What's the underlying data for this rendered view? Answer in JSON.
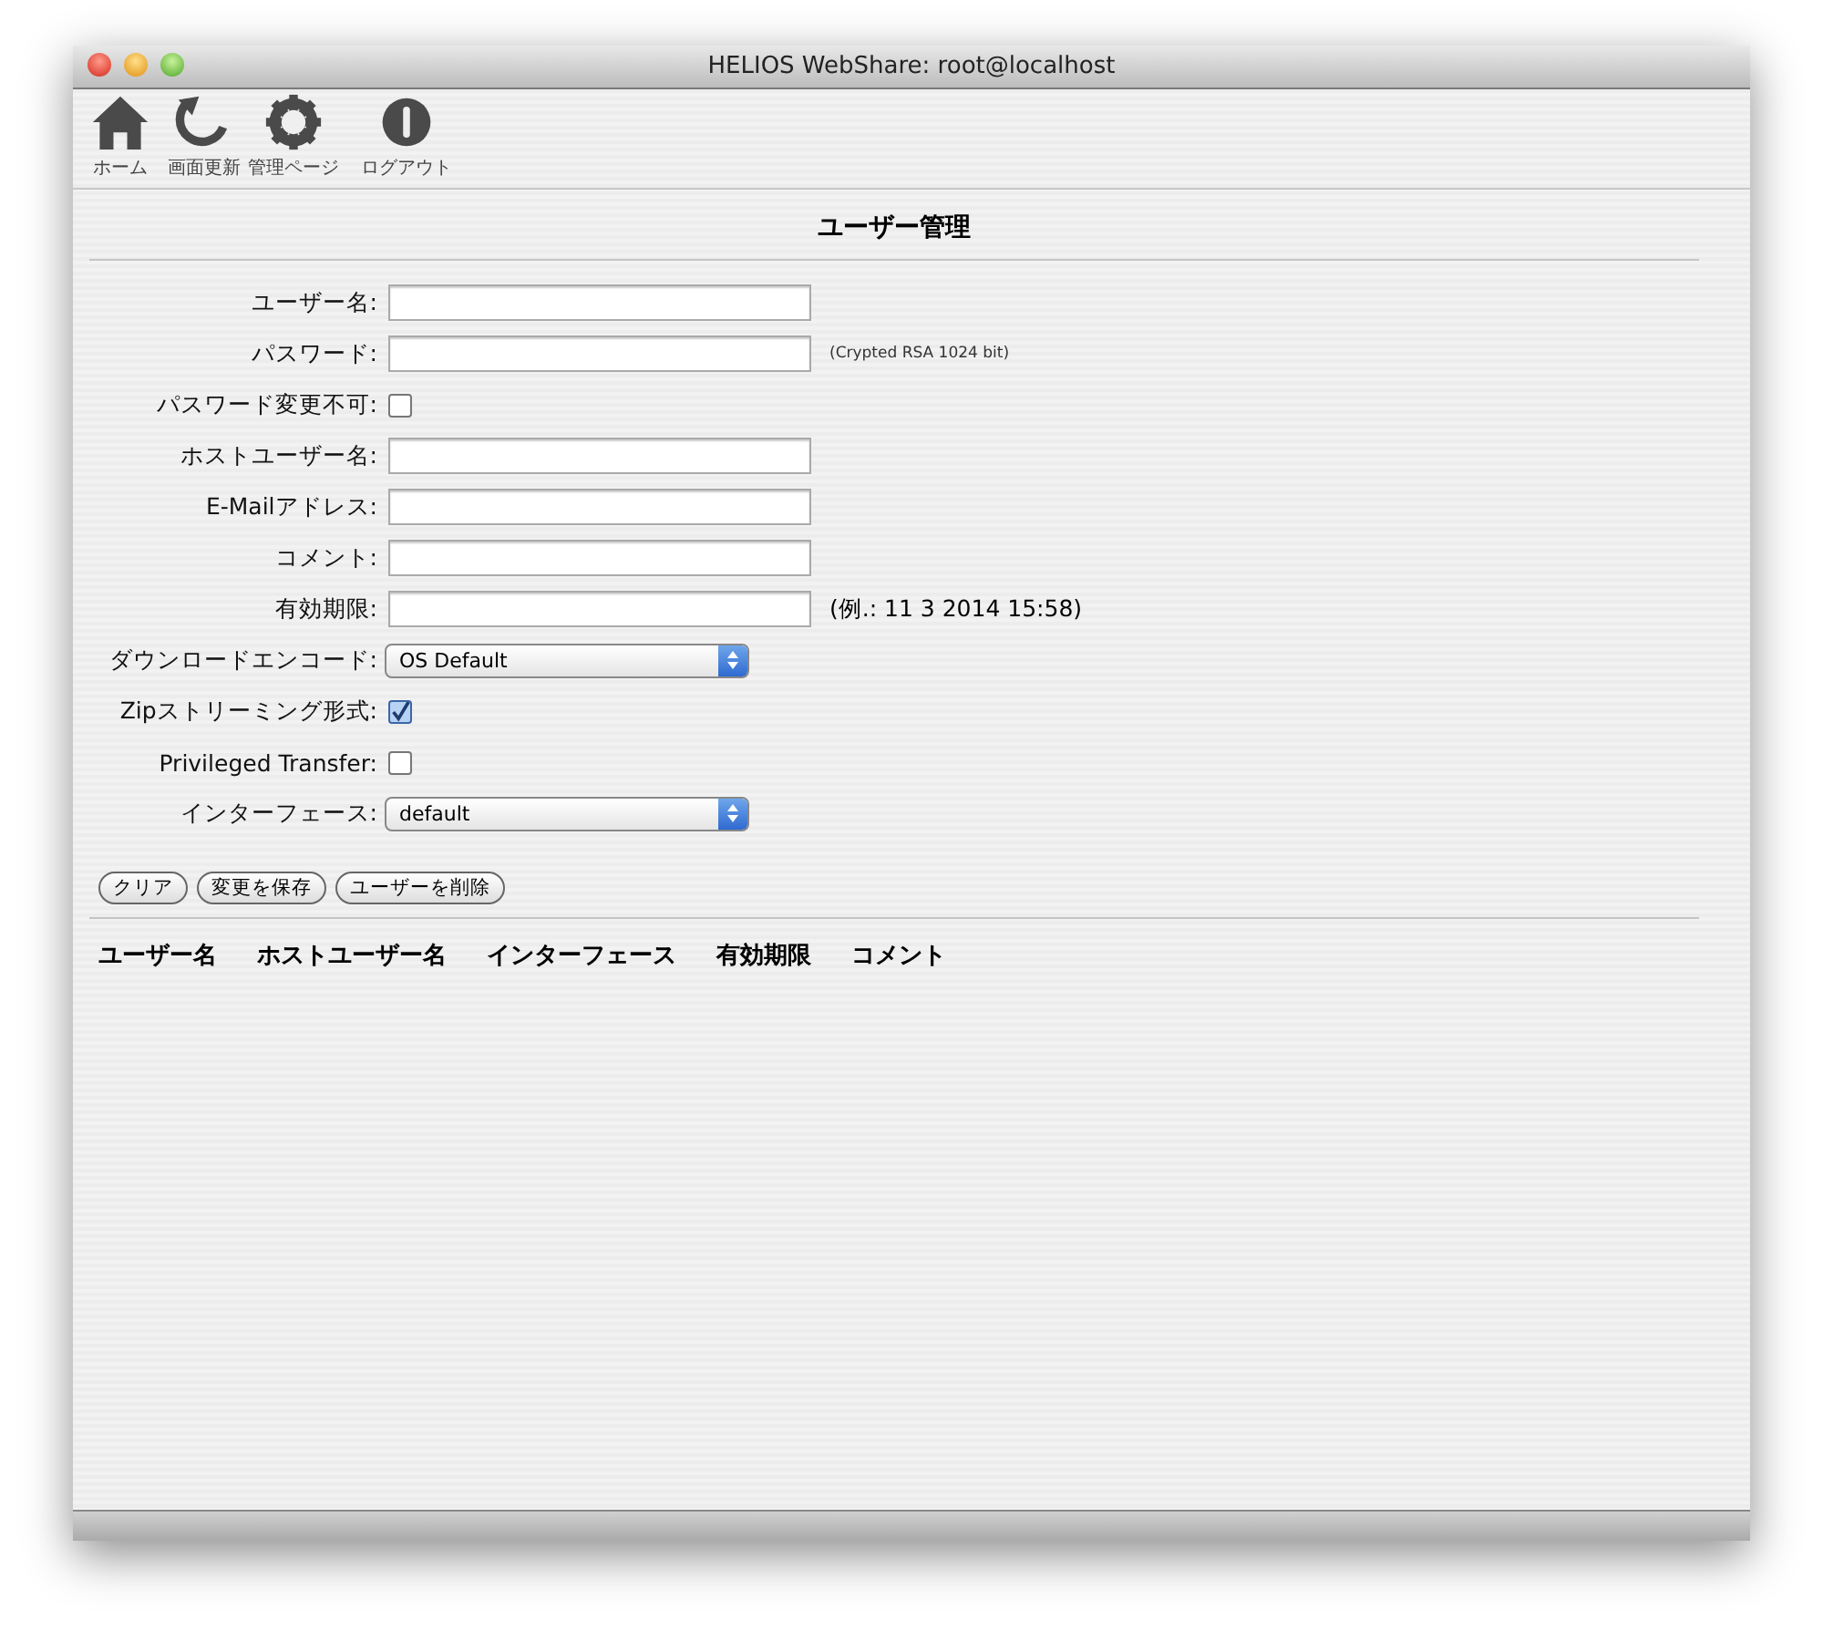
{
  "window": {
    "title": "HELIOS WebShare: root@localhost"
  },
  "toolbar": [
    {
      "kind": "home",
      "label": "ホーム"
    },
    {
      "kind": "refresh",
      "label": "画面更新"
    },
    {
      "kind": "settings",
      "label": "管理ページ"
    },
    {
      "kind": "logout",
      "label": "ログアウト"
    }
  ],
  "heading": "ユーザー管理",
  "form": [
    {
      "kind": "text",
      "label": "ユーザー名:"
    },
    {
      "kind": "text",
      "label": "パスワード:",
      "note": {
        "kind": "small",
        "text": "(Crypted RSA 1024 bit)"
      }
    },
    {
      "kind": "checkbox",
      "label": "パスワード変更不可:",
      "checked": false
    },
    {
      "kind": "text",
      "label": "ホストユーザー名:"
    },
    {
      "kind": "text",
      "label": "E-Mailアドレス:"
    },
    {
      "kind": "text",
      "label": "コメント:"
    },
    {
      "kind": "text",
      "label": "有効期限:",
      "note": {
        "kind": "normal",
        "text": "(例.: 11 3 2014 15:58)"
      }
    },
    {
      "kind": "select",
      "label": "ダウンロードエンコード:",
      "value": "OS Default"
    },
    {
      "kind": "checkbox",
      "label": "Zipストリーミング形式:",
      "checked": true
    },
    {
      "kind": "checkbox",
      "label": "Privileged Transfer:",
      "checked": false
    },
    {
      "kind": "select",
      "label": "インターフェース:",
      "value": "default"
    }
  ],
  "buttons": [
    "クリア",
    "変更を保存",
    "ユーザーを削除"
  ],
  "table": {
    "columns": [
      "ユーザー名",
      "ホストユーザー名",
      "インターフェース",
      "有効期限",
      "コメント"
    ]
  }
}
